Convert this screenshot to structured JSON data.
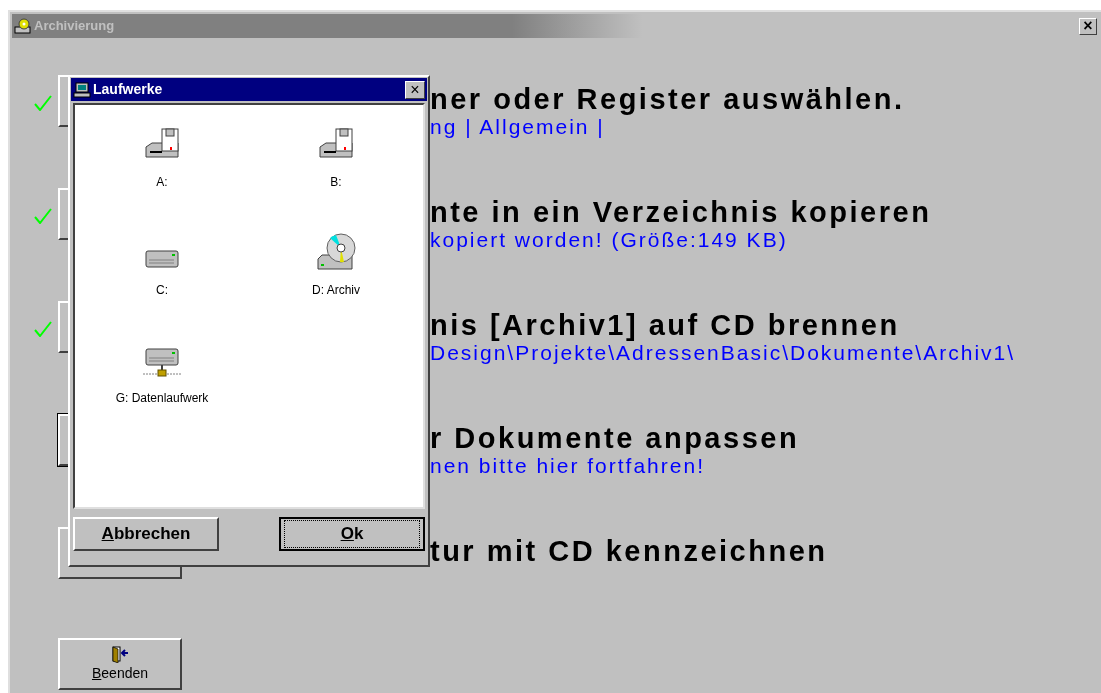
{
  "window": {
    "title": "Archivierung",
    "close": "×"
  },
  "steps": [
    {
      "done": true,
      "heading": "ner oder Register auswählen.",
      "detail": "ng | Allgemein |"
    },
    {
      "done": true,
      "heading": "nte in ein Verzeichnis kopieren",
      "detail": "kopiert worden! (Größe:149 KB)"
    },
    {
      "done": true,
      "heading": "nis [Archiv1] auf CD brennen",
      "detail": "Design\\Projekte\\AdressenBasic\\Dokumente\\Archiv1\\"
    },
    {
      "done": false,
      "heading": "r Dokumente anpassen",
      "detail": "nen bitte hier fortfahren!"
    },
    {
      "done": false,
      "heading": "tur mit CD kennzeichnen"
    }
  ],
  "exit_button": {
    "label": "Beenden"
  },
  "dialog": {
    "title": "Laufwerke",
    "close": "×",
    "drives": [
      {
        "label": "A:",
        "kind": "floppy"
      },
      {
        "label": "B:",
        "kind": "floppy"
      },
      {
        "label": "C:",
        "kind": "hdd"
      },
      {
        "label": "D: Archiv",
        "kind": "cdrom"
      },
      {
        "label": "G: Datenlaufwerk",
        "kind": "network"
      }
    ],
    "buttons": [
      {
        "label": "Abbrechen",
        "default": false
      },
      {
        "label": "Ok",
        "default": true
      }
    ]
  }
}
